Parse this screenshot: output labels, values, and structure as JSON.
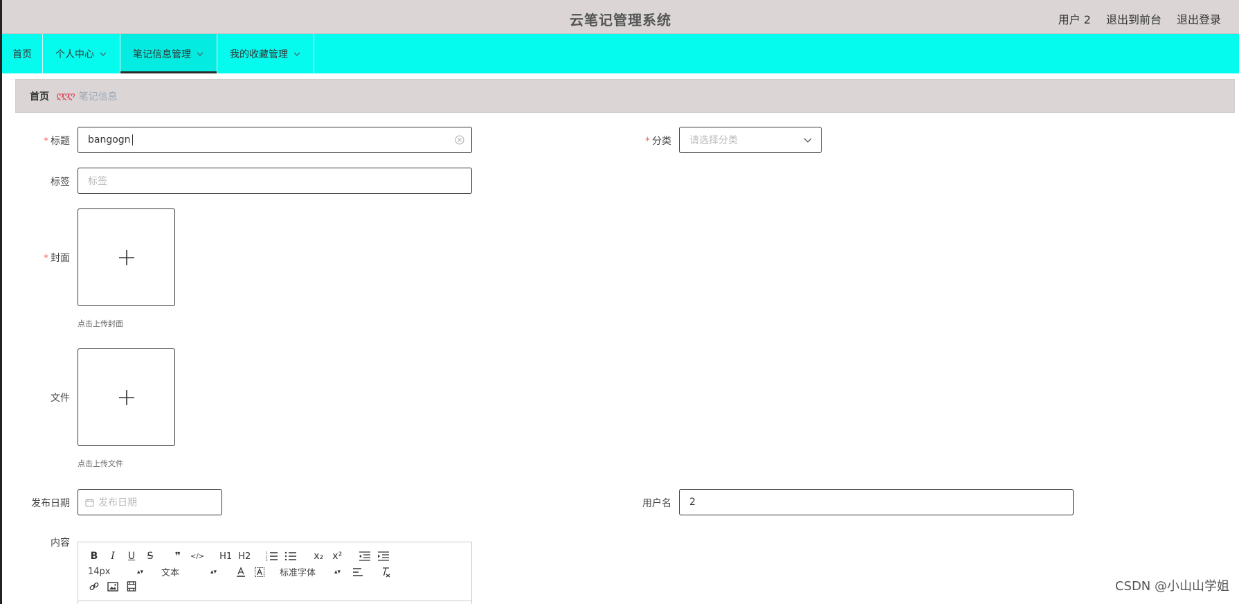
{
  "header": {
    "title": "云笔记管理系统",
    "user": "用户 2",
    "to_front": "退出到前台",
    "logout": "退出登录"
  },
  "nav": {
    "items": [
      {
        "label": "首页"
      },
      {
        "label": "个人中心"
      },
      {
        "label": "笔记信息管理"
      },
      {
        "label": "我的收藏管理"
      }
    ],
    "active_index": 2
  },
  "breadcrumb": {
    "home": "首页",
    "separator": "ღღღ",
    "current": "笔记信息"
  },
  "form": {
    "title_label": "标题",
    "title_value": "bangogn",
    "category_label": "分类",
    "category_placeholder": "请选择分类",
    "tag_label": "标签",
    "tag_placeholder": "标签",
    "cover_label": "封面",
    "cover_hint": "点击上传封面",
    "file_label": "文件",
    "file_hint": "点击上传文件",
    "date_label": "发布日期",
    "date_placeholder": "发布日期",
    "username_label": "用户名",
    "username_value": "2",
    "content_label": "内容"
  },
  "editor": {
    "row1": [
      "B",
      "I",
      "U",
      "S",
      "❞",
      "</>",
      "H1",
      "H2",
      "ol",
      "ul",
      "x₂",
      "x²",
      "outdent",
      "indent"
    ],
    "font_size": "14px",
    "header_type": "文本",
    "font_family": "标准字体"
  },
  "watermark": "CSDN @小山山学姐",
  "colors": {
    "nav_bg": "#06fbef",
    "header_bg": "#dbd5d5",
    "required": "#f56c6c"
  }
}
